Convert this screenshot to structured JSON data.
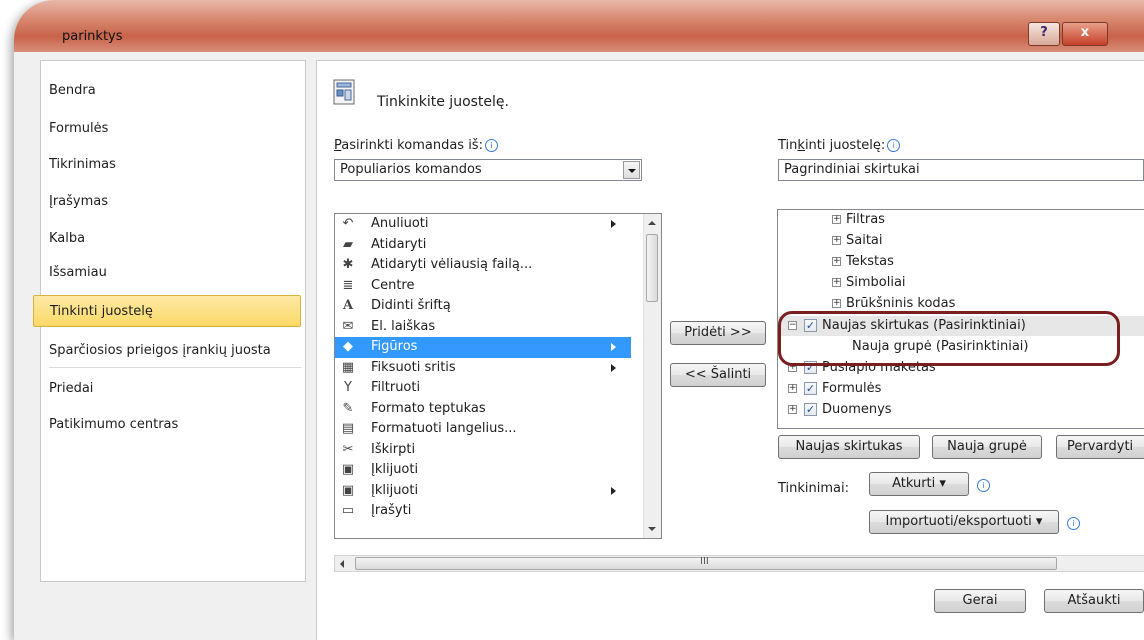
{
  "window": {
    "title": "parinktys",
    "help_label": "?",
    "close_label": "x"
  },
  "nav": {
    "items": [
      {
        "label": "Bendra"
      },
      {
        "label": "Formulės"
      },
      {
        "label": "Tikrinimas"
      },
      {
        "label": "Įrašymas"
      },
      {
        "label": "Kalba"
      },
      {
        "label": "Išsamiau"
      },
      {
        "label": "Tinkinti juostelę"
      },
      {
        "label": "Sparčiosios prieigos įrankių juosta"
      },
      {
        "label": "Priedai"
      },
      {
        "label": "Patikimumo centras"
      }
    ],
    "selected": "Tinkinti juostelę"
  },
  "main": {
    "header": "Tinkinkite juostelę.",
    "choose_label_pre": "P",
    "choose_label_post": "asirinkti komandas iš:",
    "choose_value": "Populiarios komandos",
    "customize_label_pre": "Tin",
    "customize_label_u": "k",
    "customize_label_post": "inti juostelę:",
    "customize_value": "Pagrindiniai skirtukai",
    "info_glyph": "i"
  },
  "commands": [
    {
      "icon": "undo-icon",
      "glyph": "↶",
      "label": "Anuliuoti",
      "submenu": true
    },
    {
      "icon": "open-folder-icon",
      "glyph": "▰",
      "label": "Atidaryti",
      "submenu": false
    },
    {
      "icon": "recent-file-icon",
      "glyph": "✱",
      "label": "Atidaryti vėliausią failą...",
      "submenu": false
    },
    {
      "icon": "center-align-icon",
      "glyph": "≣",
      "label": "Centre",
      "submenu": false
    },
    {
      "icon": "grow-font-icon",
      "glyph": "A",
      "label": "Didinti šriftą",
      "submenu": false
    },
    {
      "icon": "email-icon",
      "glyph": "✉",
      "label": "El. laiškas",
      "submenu": false
    },
    {
      "icon": "shapes-icon",
      "glyph": "◆",
      "label": "Figūros",
      "submenu": true
    },
    {
      "icon": "freeze-panes-icon",
      "glyph": "▦",
      "label": "Fiksuoti sritis",
      "submenu": true
    },
    {
      "icon": "filter-icon",
      "glyph": "Y",
      "label": "Filtruoti",
      "submenu": false
    },
    {
      "icon": "format-painter-icon",
      "glyph": "✎",
      "label": "Formato teptukas",
      "submenu": false
    },
    {
      "icon": "format-cells-icon",
      "glyph": "▤",
      "label": "Formatuoti langelius...",
      "submenu": false
    },
    {
      "icon": "cut-icon",
      "glyph": "✂",
      "label": "Iškirpti",
      "submenu": false
    },
    {
      "icon": "paste-icon",
      "glyph": "▣",
      "label": "Įklijuoti",
      "submenu": false
    },
    {
      "icon": "paste-menu-icon",
      "glyph": "▣",
      "label": "Įklijuoti",
      "submenu": true
    },
    {
      "icon": "save-icon",
      "glyph": "▭",
      "label": "Įrašyti",
      "submenu": false
    }
  ],
  "selected_command": "Figūros",
  "add_button": "Pridėti >>",
  "remove_button": "<< Šalinti",
  "tree": [
    {
      "label": "Filtras",
      "expander": "+",
      "checkbox": false,
      "indent": 1
    },
    {
      "label": "Saitai",
      "expander": "+",
      "checkbox": false,
      "indent": 1
    },
    {
      "label": "Tekstas",
      "expander": "+",
      "checkbox": false,
      "indent": 1
    },
    {
      "label": "Simboliai",
      "expander": "+",
      "checkbox": false,
      "indent": 1
    },
    {
      "label": "Brūkšninis kodas",
      "expander": "+",
      "checkbox": false,
      "indent": 1
    },
    {
      "label": "Naujas skirtukas (Pasirinktiniai)",
      "expander": "−",
      "checkbox": true,
      "checked": true,
      "indent": 0
    },
    {
      "label": "Nauja grupė (Pasirinktiniai)",
      "expander": "",
      "checkbox": false,
      "indent": 2
    },
    {
      "label": "Puslapio maketas",
      "expander": "+",
      "checkbox": true,
      "checked": true,
      "indent": 0
    },
    {
      "label": "Formulės",
      "expander": "+",
      "checkbox": true,
      "checked": true,
      "indent": 0
    },
    {
      "label": "Duomenys",
      "expander": "+",
      "checkbox": true,
      "checked": true,
      "indent": 0
    }
  ],
  "checkmark": "✓",
  "tree_buttons": {
    "new_tab": "Naujas skirtukas",
    "new_group": "Nauja grupė",
    "rename": "Pervardyti"
  },
  "customizations": {
    "label": "Tinkinimai:",
    "reset": "Atkurti",
    "import_export": "Importuoti/eksportuoti"
  },
  "footer": {
    "ok": "Gerai",
    "cancel": "Atšaukti"
  },
  "scroll_grip": "III"
}
